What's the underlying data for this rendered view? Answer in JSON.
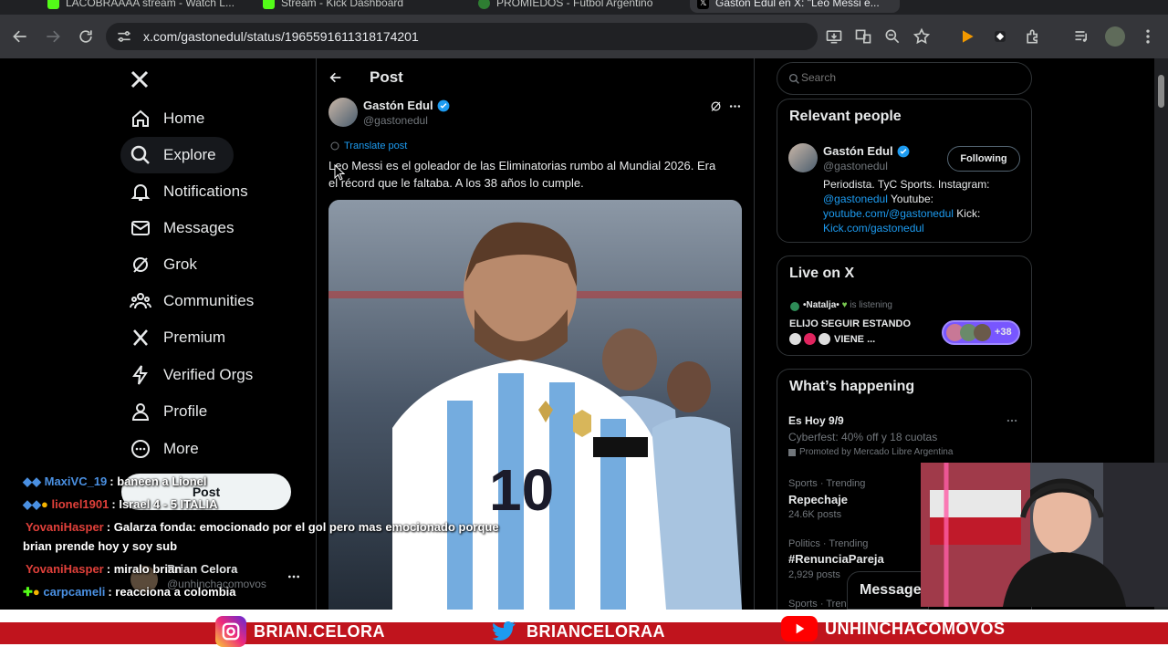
{
  "browser": {
    "tabs": [
      {
        "label": "LACOBRAAAA stream - Watch L..."
      },
      {
        "label": "Stream - Kick Dashboard"
      },
      {
        "label": "PROMIEDOS - Futbol Argentino"
      },
      {
        "label": "Gastón Edul en X: \"Leo Messi e..."
      }
    ],
    "url": "x.com/gastonedul/status/1965591611318174201"
  },
  "nav": {
    "items": [
      {
        "label": "Home"
      },
      {
        "label": "Explore"
      },
      {
        "label": "Notifications"
      },
      {
        "label": "Messages"
      },
      {
        "label": "Grok"
      },
      {
        "label": "Communities"
      },
      {
        "label": "Premium"
      },
      {
        "label": "Verified Orgs"
      },
      {
        "label": "Profile"
      },
      {
        "label": "More"
      }
    ],
    "post_button": "Post",
    "account_name": "Brian Celora",
    "account_handle": "@unhinchacomovos"
  },
  "post": {
    "header": "Post",
    "author_name": "Gastón Edul",
    "author_handle": "@gastonedul",
    "translate": "Translate post",
    "text_line1": "Leo Messi es el goleador de las Eliminatorias rumbo al Mundial 2026. Era",
    "text_line2": "el récord que le faltaba. A los 38 años lo cumple.",
    "jersey_number": "10"
  },
  "sidebar": {
    "search_placeholder": "Search",
    "relevant": {
      "title": "Relevant people",
      "name": "Gastón Edul",
      "handle": "@gastonedul",
      "follow_button": "Following",
      "bio_text1": "Periodista. TyC Sports. Instagram:",
      "bio_link1": "@gastonedul",
      "bio_text2": " Youtube:",
      "bio_link2": "youtube.com/@gastonedul",
      "bio_text3": " Kick:",
      "bio_link3": "Kick.com/gastonedul"
    },
    "live": {
      "title": "Live on X",
      "listener": "•Natalja•",
      "status": "is listening",
      "space_title": "ELIJO SEGUIR ESTANDO",
      "space_title2": "VIENE ...",
      "count": "+38"
    },
    "happening": {
      "title": "What’s happening",
      "promo_title": "Es Hoy 9/9",
      "promo_subtitle": "Cyberfest: 40% off y 18 cuotas",
      "promo_by": "Promoted by Mercado Libre Argentina",
      "trends": [
        {
          "category": "Sports · Trending",
          "name": "Repechaje",
          "posts": "24.6K posts"
        },
        {
          "category": "Politics · Trending",
          "name": "#RenunciaPareja",
          "posts": "2,929 posts"
        },
        {
          "category": "Sports · Trending",
          "name": "",
          "posts": ""
        }
      ]
    },
    "messages_label": "Messages"
  },
  "chat": [
    {
      "user": "MaxiVC_19",
      "sep": ":",
      "msg": "baneen a Lionel",
      "color": "#4a90e2"
    },
    {
      "user": "lionel1901",
      "sep": ":",
      "msg": "Israel 4 - 5 ITALIA",
      "color": "#e0403a"
    },
    {
      "user": "YovaniHasper",
      "sep": ":",
      "msg": "Galarza fonda: emocionado por el gol pero mas emocionado porque",
      "msg2": "brian prende hoy y soy sub",
      "color": "#e0403a"
    },
    {
      "user": "YovaniHasper",
      "sep": ":",
      "msg": "miralo brian",
      "color": "#e0403a"
    },
    {
      "user": "carpcameli",
      "sep": ":",
      "msg": "reacciona a colombia",
      "color": "#4a90e2"
    }
  ],
  "banner": {
    "instagram": "BRIAN.CELORA",
    "twitter": "BRIANCELORAA",
    "youtube": "UNHINCHACOMOVOS"
  },
  "colors": {
    "accent": "#1d9bf0",
    "banner_red": "#c0141d",
    "live_purple": "#7856ff"
  }
}
